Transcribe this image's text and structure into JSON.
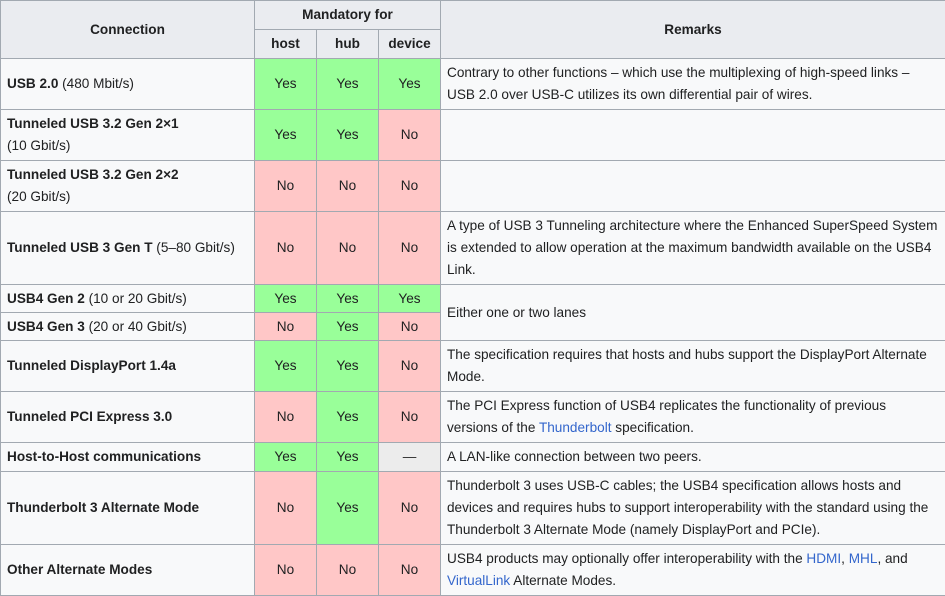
{
  "header": {
    "connection": "Connection",
    "mandatory_for": "Mandatory for",
    "host": "host",
    "hub": "hub",
    "device": "device",
    "remarks": "Remarks"
  },
  "rows": [
    {
      "name": "USB 2.0",
      "detail": " (480 Mbit/s)",
      "host": "Yes",
      "hub": "Yes",
      "device": "Yes",
      "remarks": [
        "Contrary to other functions – which use the multiplexing of high-speed links – USB 2.0 over USB-C utilizes its own differential pair of wires."
      ]
    },
    {
      "name": "Tunneled USB 3.2 Gen 2×1",
      "detail": "(10 Gbit/s)",
      "host": "Yes",
      "hub": "Yes",
      "device": "No",
      "remarks": [
        ""
      ]
    },
    {
      "name": "Tunneled USB 3.2 Gen 2×2",
      "detail": "(20 Gbit/s)",
      "host": "No",
      "hub": "No",
      "device": "No",
      "remarks": [
        ""
      ]
    },
    {
      "name": "Tunneled USB 3 Gen T",
      "detail": " (5–80 Gbit/s)",
      "host": "No",
      "hub": "No",
      "device": "No",
      "remarks": [
        "A type of USB 3 Tunneling architecture where the Enhanced SuperSpeed System is extended to allow operation at the maximum bandwidth available on the USB4 Link."
      ]
    },
    {
      "name": "USB4 Gen 2",
      "detail": " (10 or 20 Gbit/s)",
      "host": "Yes",
      "hub": "Yes",
      "device": "Yes",
      "remarks": [
        "Either one or two lanes"
      ]
    },
    {
      "name": "USB4 Gen 3",
      "detail": " (20 or 40 Gbit/s)",
      "host": "No",
      "hub": "Yes",
      "device": "No"
    },
    {
      "name": "Tunneled DisplayPort 1.4a",
      "detail": "",
      "host": "Yes",
      "hub": "Yes",
      "device": "No",
      "remarks": [
        "The specification requires that hosts and hubs support the DisplayPort Alternate Mode."
      ]
    },
    {
      "name": "Tunneled PCI Express 3.0",
      "detail": "",
      "host": "No",
      "hub": "Yes",
      "device": "No",
      "remarks": [
        "The PCI Express function of USB4 replicates the functionality of previous versions of the ",
        "Thunderbolt",
        " specification."
      ]
    },
    {
      "name": "Host-to-Host communications",
      "detail": "",
      "host": "Yes",
      "hub": "Yes",
      "device": "—",
      "remarks": [
        "A LAN-like connection between two peers."
      ]
    },
    {
      "name": "Thunderbolt 3 Alternate Mode",
      "detail": "",
      "host": "No",
      "hub": "Yes",
      "device": "No",
      "remarks": [
        "Thunderbolt 3 uses USB-C cables; the USB4 specification allows hosts and devices and requires hubs to support interoperability with the standard using the Thunderbolt 3 Alternate Mode (namely DisplayPort and PCIe)."
      ]
    },
    {
      "name": "Other Alternate Modes",
      "detail": "",
      "host": "No",
      "hub": "No",
      "device": "No",
      "remarks": [
        "USB4 products may optionally offer interoperability with the ",
        "HDMI",
        ", ",
        "MHL",
        ", and ",
        "VirtualLink",
        " Alternate Modes."
      ]
    }
  ],
  "colors": {
    "yes": "#99ff99",
    "no": "#ffc7c7",
    "na": "#ececec",
    "header": "#eaecf0",
    "link": "#3366cc"
  }
}
